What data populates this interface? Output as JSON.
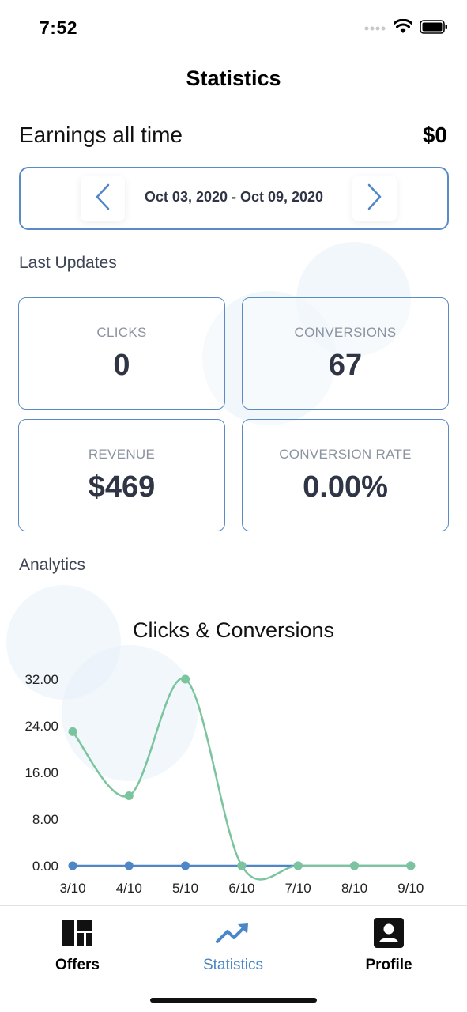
{
  "status_bar": {
    "time": "7:52"
  },
  "header": {
    "title": "Statistics"
  },
  "earnings": {
    "label": "Earnings all time",
    "value": "$0"
  },
  "date_range": {
    "text": "Oct 03, 2020 - Oct 09, 2020"
  },
  "last_updates": {
    "label": "Last Updates",
    "cards": [
      {
        "label": "CLICKS",
        "value": "0"
      },
      {
        "label": "CONVERSIONS",
        "value": "67"
      },
      {
        "label": "REVENUE",
        "value": "$469"
      },
      {
        "label": "CONVERSION RATE",
        "value": "0.00%"
      }
    ]
  },
  "analytics": {
    "label": "Analytics"
  },
  "chart_data": {
    "type": "line",
    "title": "Clicks & Conversions",
    "categories": [
      "3/10",
      "4/10",
      "5/10",
      "6/10",
      "7/10",
      "8/10",
      "9/10"
    ],
    "y_ticks": [
      "0.00",
      "8.00",
      "16.00",
      "24.00",
      "32.00"
    ],
    "ylim": [
      0,
      32
    ],
    "grid": false,
    "series": [
      {
        "color": "#7cc49e",
        "values": [
          23,
          12,
          32,
          0,
          0,
          0,
          0
        ]
      },
      {
        "color": "#4f86c6",
        "values": [
          0,
          0,
          0,
          0,
          0,
          0,
          0
        ]
      }
    ]
  },
  "tabs": [
    {
      "label": "Offers",
      "icon": "dashboard-icon",
      "active": false
    },
    {
      "label": "Statistics",
      "icon": "trending-up-icon",
      "active": true
    },
    {
      "label": "Profile",
      "icon": "profile-icon",
      "active": false
    }
  ],
  "colors": {
    "accent": "#4a86c8",
    "card_border": "#5b8bc5",
    "text_dark": "#2f3545",
    "text_muted": "#8c93a0"
  }
}
